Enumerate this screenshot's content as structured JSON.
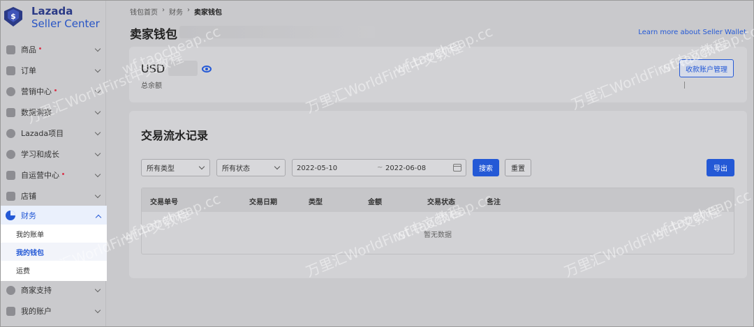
{
  "brand": {
    "name_line1": "Lazada",
    "name_line2": "Seller Center",
    "logo_color": "#2b3a86",
    "accent": "#2459d6"
  },
  "sidebar": {
    "items": [
      {
        "label": "商品",
        "icon": "product-icon",
        "badge": true
      },
      {
        "label": "订单",
        "icon": "order-icon",
        "badge": false
      },
      {
        "label": "营销中心",
        "icon": "marketing-icon",
        "badge": true
      },
      {
        "label": "数据洞察",
        "icon": "data-icon",
        "badge": false
      },
      {
        "label": "Lazada项目",
        "icon": "program-icon",
        "badge": false
      },
      {
        "label": "学习和成长",
        "icon": "learning-icon",
        "badge": false
      },
      {
        "label": "自运营中心",
        "icon": "self-ops-icon",
        "badge": true
      },
      {
        "label": "店铺",
        "icon": "store-icon",
        "badge": false
      }
    ],
    "finance": {
      "label": "财务",
      "icon": "pie-chart-icon",
      "sub_items": [
        {
          "label": "我的账单",
          "active": false
        },
        {
          "label": "我的钱包",
          "active": true
        },
        {
          "label": "运费",
          "active": false
        }
      ]
    },
    "bottom_items": [
      {
        "label": "商家支持",
        "icon": "help-icon"
      },
      {
        "label": "我的账户",
        "icon": "account-icon"
      }
    ]
  },
  "breadcrumb": [
    "钱包首页",
    "财务",
    "卖家钱包"
  ],
  "page_title": "卖家钱包",
  "learn_more": "Learn more about Seller Wallet",
  "balance": {
    "currency": "USD",
    "label": "总余额",
    "manage_button": "收款账户管理"
  },
  "transactions": {
    "title": "交易流水记录",
    "filters": {
      "type": "所有类型",
      "status": "所有状态",
      "date_start": "2022-05-10",
      "date_sep": "~",
      "date_end": "2022-06-08"
    },
    "search_button": "搜索",
    "reset_button": "重置",
    "export_button": "导出",
    "columns": [
      "交易单号",
      "交易日期",
      "类型",
      "金额",
      "交易状态",
      "备注"
    ],
    "empty_text": "暂无数据"
  },
  "watermark": [
    "万里汇WorldFirst中文教程",
    "wf.taocheap.cc"
  ]
}
